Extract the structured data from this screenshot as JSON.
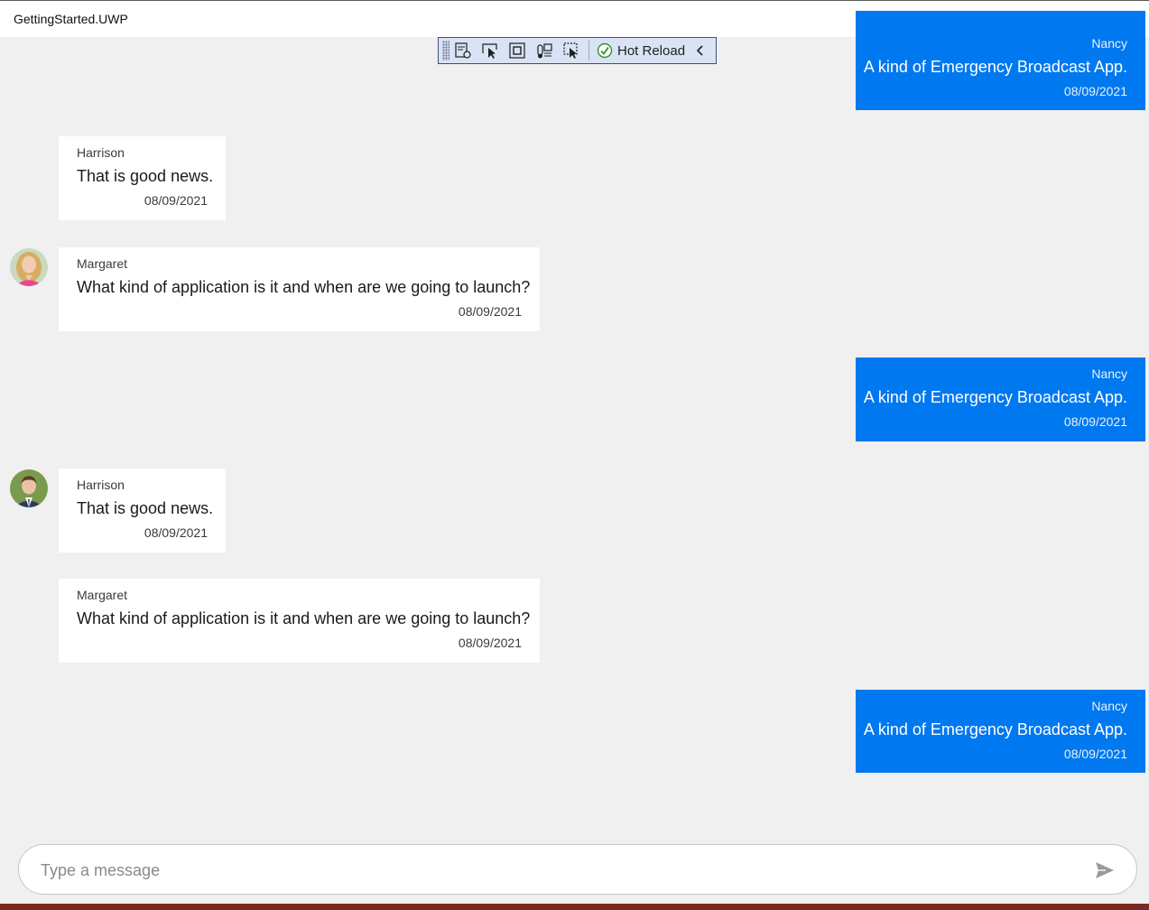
{
  "window": {
    "title": "GettingStarted.UWP"
  },
  "hot_reload_toolbar": {
    "label": "Hot Reload"
  },
  "messages": [
    {
      "author": "Nancy",
      "text": "A kind of Emergency Broadcast App.",
      "date": "08/09/2021",
      "outgoing": true
    },
    {
      "author": "Harrison",
      "text": "That is good news.",
      "date": "08/09/2021",
      "outgoing": false
    },
    {
      "author": "Margaret",
      "text": "What kind of application is it and when are we going to launch?",
      "date": "08/09/2021",
      "outgoing": false
    },
    {
      "author": "Nancy",
      "text": "A kind of Emergency Broadcast App.",
      "date": "08/09/2021",
      "outgoing": true
    },
    {
      "author": "Harrison",
      "text": "That is good news.",
      "date": "08/09/2021",
      "outgoing": false
    },
    {
      "author": "Margaret",
      "text": "What kind of application is it and when are we going to launch?",
      "date": "08/09/2021",
      "outgoing": false
    },
    {
      "author": "Nancy",
      "text": "A kind of Emergency Broadcast App.",
      "date": "08/09/2021",
      "outgoing": true
    }
  ],
  "composer": {
    "placeholder": "Type a message"
  },
  "colors": {
    "outgoing_bubble": "#0078f0",
    "incoming_bubble": "#ffffff",
    "background": "#f0f0f0"
  }
}
